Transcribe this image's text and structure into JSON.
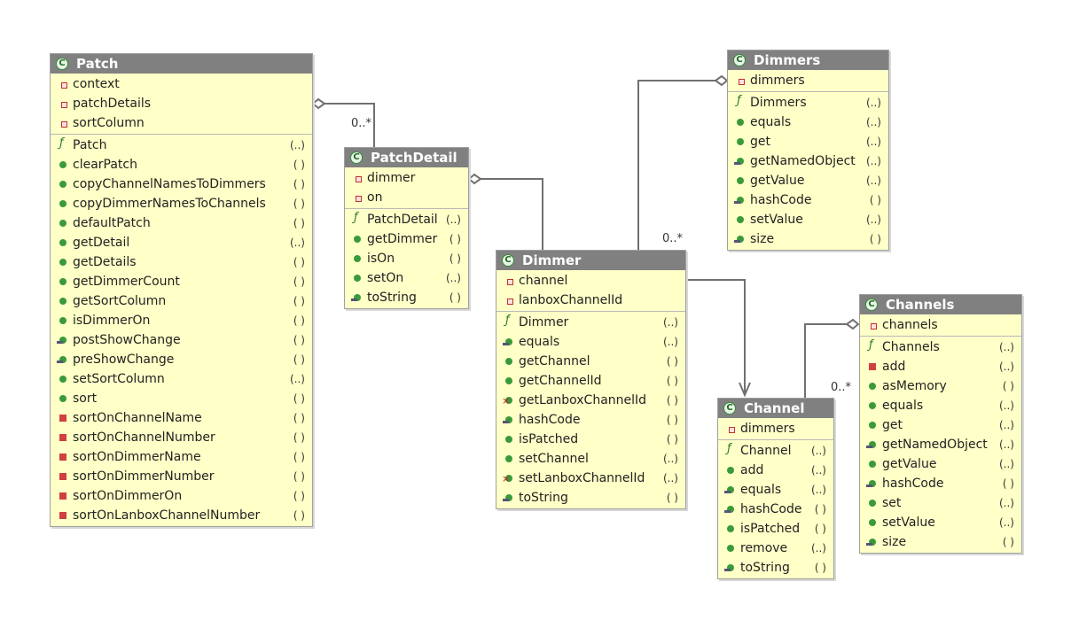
{
  "classes": {
    "patch": {
      "name": "Patch",
      "fields": [
        {
          "name": "context",
          "kind": "field"
        },
        {
          "name": "patchDetails",
          "kind": "field"
        },
        {
          "name": "sortColumn",
          "kind": "field"
        }
      ],
      "methods": [
        {
          "name": "Patch",
          "args": "(..)",
          "kind": "ctor"
        },
        {
          "name": "clearPatch",
          "args": "( )",
          "kind": "pub"
        },
        {
          "name": "copyChannelNamesToDimmers",
          "args": "( )",
          "kind": "pub"
        },
        {
          "name": "copyDimmerNamesToChannels",
          "args": "( )",
          "kind": "pub"
        },
        {
          "name": "defaultPatch",
          "args": "( )",
          "kind": "pub"
        },
        {
          "name": "getDetail",
          "args": "(..)",
          "kind": "pub"
        },
        {
          "name": "getDetails",
          "args": "( )",
          "kind": "pub"
        },
        {
          "name": "getDimmerCount",
          "args": "( )",
          "kind": "pub"
        },
        {
          "name": "getSortColumn",
          "args": "( )",
          "kind": "pub"
        },
        {
          "name": "isDimmerOn",
          "args": "( )",
          "kind": "pub"
        },
        {
          "name": "postShowChange",
          "args": "( )",
          "kind": "prot"
        },
        {
          "name": "preShowChange",
          "args": "( )",
          "kind": "prot"
        },
        {
          "name": "setSortColumn",
          "args": "(..)",
          "kind": "pub"
        },
        {
          "name": "sort",
          "args": "( )",
          "kind": "pub"
        },
        {
          "name": "sortOnChannelName",
          "args": "( )",
          "kind": "priv"
        },
        {
          "name": "sortOnChannelNumber",
          "args": "( )",
          "kind": "priv"
        },
        {
          "name": "sortOnDimmerName",
          "args": "( )",
          "kind": "priv"
        },
        {
          "name": "sortOnDimmerNumber",
          "args": "( )",
          "kind": "priv"
        },
        {
          "name": "sortOnDimmerOn",
          "args": "( )",
          "kind": "priv"
        },
        {
          "name": "sortOnLanboxChannelNumber",
          "args": "( )",
          "kind": "priv"
        }
      ]
    },
    "patchdetail": {
      "name": "PatchDetail",
      "fields": [
        {
          "name": "dimmer",
          "kind": "field"
        },
        {
          "name": "on",
          "kind": "field"
        }
      ],
      "methods": [
        {
          "name": "PatchDetail",
          "args": "(..)",
          "kind": "ctor"
        },
        {
          "name": "getDimmer",
          "args": "( )",
          "kind": "pub"
        },
        {
          "name": "isOn",
          "args": "( )",
          "kind": "pub"
        },
        {
          "name": "setOn",
          "args": "(..)",
          "kind": "pub"
        },
        {
          "name": "toString",
          "args": "( )",
          "kind": "prot"
        }
      ]
    },
    "dimmer": {
      "name": "Dimmer",
      "fields": [
        {
          "name": "channel",
          "kind": "field"
        },
        {
          "name": "lanboxChannelId",
          "kind": "field"
        }
      ],
      "methods": [
        {
          "name": "Dimmer",
          "args": "(..)",
          "kind": "ctor"
        },
        {
          "name": "equals",
          "args": "(..)",
          "kind": "prot"
        },
        {
          "name": "getChannel",
          "args": "( )",
          "kind": "pub"
        },
        {
          "name": "getChannelId",
          "args": "( )",
          "kind": "pub"
        },
        {
          "name": "getLanboxChannelId",
          "args": "( )",
          "kind": "priv-x"
        },
        {
          "name": "hashCode",
          "args": "( )",
          "kind": "prot"
        },
        {
          "name": "isPatched",
          "args": "( )",
          "kind": "pub"
        },
        {
          "name": "setChannel",
          "args": "(..)",
          "kind": "pub"
        },
        {
          "name": "setLanboxChannelId",
          "args": "(..)",
          "kind": "priv-x"
        },
        {
          "name": "toString",
          "args": "( )",
          "kind": "prot"
        }
      ]
    },
    "dimmers": {
      "name": "Dimmers",
      "fields": [
        {
          "name": "dimmers",
          "kind": "field"
        }
      ],
      "methods": [
        {
          "name": "Dimmers",
          "args": "(..)",
          "kind": "ctor"
        },
        {
          "name": "equals",
          "args": "(..)",
          "kind": "pub"
        },
        {
          "name": "get",
          "args": "(..)",
          "kind": "pub"
        },
        {
          "name": "getNamedObject",
          "args": "(..)",
          "kind": "prot"
        },
        {
          "name": "getValue",
          "args": "(..)",
          "kind": "pub"
        },
        {
          "name": "hashCode",
          "args": "( )",
          "kind": "prot"
        },
        {
          "name": "setValue",
          "args": "(..)",
          "kind": "pub"
        },
        {
          "name": "size",
          "args": "( )",
          "kind": "prot"
        }
      ]
    },
    "channel": {
      "name": "Channel",
      "fields": [
        {
          "name": "dimmers",
          "kind": "field"
        }
      ],
      "methods": [
        {
          "name": "Channel",
          "args": "(..)",
          "kind": "ctor"
        },
        {
          "name": "add",
          "args": "(..)",
          "kind": "pub"
        },
        {
          "name": "equals",
          "args": "(..)",
          "kind": "prot"
        },
        {
          "name": "hashCode",
          "args": "( )",
          "kind": "prot"
        },
        {
          "name": "isPatched",
          "args": "( )",
          "kind": "pub"
        },
        {
          "name": "remove",
          "args": "(..)",
          "kind": "pub"
        },
        {
          "name": "toString",
          "args": "( )",
          "kind": "prot"
        }
      ]
    },
    "channels": {
      "name": "Channels",
      "fields": [
        {
          "name": "channels",
          "kind": "field"
        }
      ],
      "methods": [
        {
          "name": "Channels",
          "args": "(..)",
          "kind": "ctor"
        },
        {
          "name": "add",
          "args": "(..)",
          "kind": "priv"
        },
        {
          "name": "asMemory",
          "args": "( )",
          "kind": "pub"
        },
        {
          "name": "equals",
          "args": "(..)",
          "kind": "pub"
        },
        {
          "name": "get",
          "args": "(..)",
          "kind": "pub"
        },
        {
          "name": "getNamedObject",
          "args": "(..)",
          "kind": "prot"
        },
        {
          "name": "getValue",
          "args": "(..)",
          "kind": "pub"
        },
        {
          "name": "hashCode",
          "args": "( )",
          "kind": "prot"
        },
        {
          "name": "set",
          "args": "(..)",
          "kind": "pub"
        },
        {
          "name": "setValue",
          "args": "(..)",
          "kind": "pub"
        },
        {
          "name": "size",
          "args": "( )",
          "kind": "prot"
        }
      ]
    }
  },
  "multiplicities": {
    "patch_details": "0..*",
    "dimmers_dimmer": "0..*",
    "channels_channel": "0..*"
  },
  "icons": {
    "class": "class-icon",
    "field": "private-field-icon",
    "ctor": "constructor-icon",
    "pub": "public-method-icon",
    "prot": "protected-method-icon",
    "priv": "private-method-icon",
    "priv-x": "private-method-warning-icon"
  }
}
